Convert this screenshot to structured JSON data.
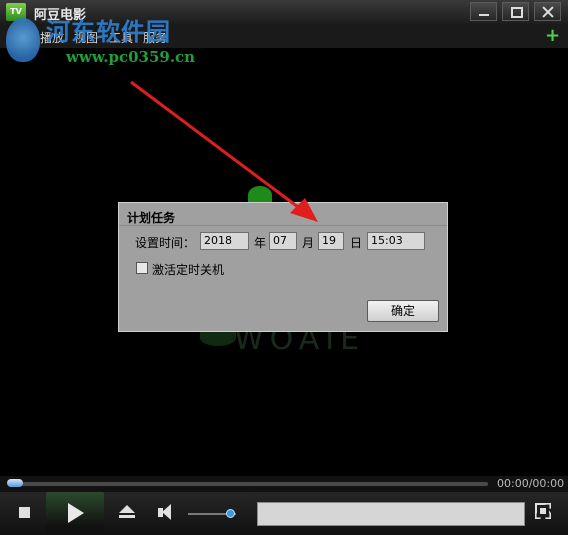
{
  "app": {
    "title": "阿豆电影",
    "icon_name": "app-logo-icon"
  },
  "window_controls": {
    "minimize": "minimize-icon",
    "maximize": "maximize-icon",
    "close": "close-icon"
  },
  "menu": {
    "items": [
      "播放",
      "视图",
      "工具",
      "服务"
    ],
    "add_button": "+"
  },
  "watermark": {
    "title": "河东软件园",
    "url": "www.pc0359.cn"
  },
  "background_logo": {
    "text": "WOAIE"
  },
  "dialog": {
    "title": "计划任务",
    "time_label": "设置时间：",
    "year": "2018",
    "year_unit": "年",
    "month": "07",
    "month_unit": "月",
    "day": "19",
    "day_unit": "日",
    "time": "15:03",
    "checkbox_label": "激活定时关机",
    "checkbox_checked": false,
    "ok_label": "确定"
  },
  "player": {
    "time_display": "00:00/00:00",
    "seek_progress": 0,
    "volume_level": 0.8
  },
  "colors": {
    "accent": "#2d7fd0",
    "plus": "#4fd14a",
    "arrow": "#e01e1e"
  }
}
